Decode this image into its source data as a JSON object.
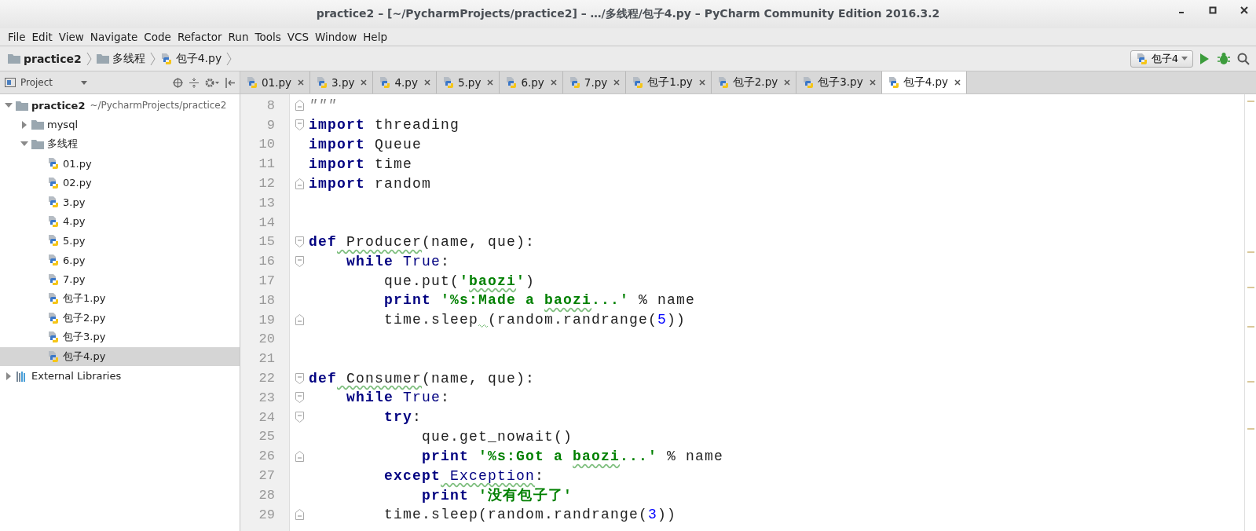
{
  "window": {
    "title": "practice2 – [~/PycharmProjects/practice2] – …/多线程/包子4.py – PyCharm Community Edition 2016.3.2"
  },
  "menu": [
    "File",
    "Edit",
    "View",
    "Navigate",
    "Code",
    "Refactor",
    "Run",
    "Tools",
    "VCS",
    "Window",
    "Help"
  ],
  "breadcrumbs": [
    {
      "label": "practice2",
      "kind": "folder"
    },
    {
      "label": "多线程",
      "kind": "folder"
    },
    {
      "label": "包子4.py",
      "kind": "file"
    }
  ],
  "run_config": {
    "label": "包子4"
  },
  "project_panel": {
    "title": "Project"
  },
  "tree": [
    {
      "label": "practice2",
      "path": "~/PycharmProjects/practice2",
      "kind": "folder",
      "expanded": true,
      "selected": false,
      "children": [
        {
          "label": "mysql",
          "kind": "folder",
          "expanded": false,
          "selected": false
        },
        {
          "label": "多线程",
          "kind": "folder",
          "expanded": true,
          "selected": false,
          "children": [
            {
              "label": "01.py",
              "kind": "file",
              "selected": false
            },
            {
              "label": "02.py",
              "kind": "file",
              "selected": false
            },
            {
              "label": "3.py",
              "kind": "file",
              "selected": false
            },
            {
              "label": "4.py",
              "kind": "file",
              "selected": false
            },
            {
              "label": "5.py",
              "kind": "file",
              "selected": false
            },
            {
              "label": "6.py",
              "kind": "file",
              "selected": false
            },
            {
              "label": "7.py",
              "kind": "file",
              "selected": false
            },
            {
              "label": "包子1.py",
              "kind": "file",
              "selected": false
            },
            {
              "label": "包子2.py",
              "kind": "file",
              "selected": false
            },
            {
              "label": "包子3.py",
              "kind": "file",
              "selected": false
            },
            {
              "label": "包子4.py",
              "kind": "file",
              "selected": true
            }
          ]
        }
      ]
    },
    {
      "label": "External Libraries",
      "kind": "library",
      "expanded": false,
      "selected": false
    }
  ],
  "tabs": [
    {
      "label": "01.py",
      "selected": false
    },
    {
      "label": "3.py",
      "selected": false
    },
    {
      "label": "4.py",
      "selected": false
    },
    {
      "label": "5.py",
      "selected": false
    },
    {
      "label": "6.py",
      "selected": false
    },
    {
      "label": "7.py",
      "selected": false
    },
    {
      "label": "包子1.py",
      "selected": false
    },
    {
      "label": "包子2.py",
      "selected": false
    },
    {
      "label": "包子3.py",
      "selected": false
    },
    {
      "label": "包子4.py",
      "selected": true
    }
  ],
  "code": [
    {
      "number": "8",
      "fold_end": true,
      "tokens": [
        {
          "t": "\"\"\"",
          "kind": "doc"
        }
      ]
    },
    {
      "number": "9",
      "fold_start": true,
      "tokens": [
        {
          "t": "import",
          "kind": "kw"
        },
        {
          "t": " threading",
          "kind": "plain"
        }
      ]
    },
    {
      "number": "10",
      "tokens": [
        {
          "t": "import",
          "kind": "kw"
        },
        {
          "t": " Queue",
          "kind": "plain"
        }
      ]
    },
    {
      "number": "11",
      "tokens": [
        {
          "t": "import",
          "kind": "kw"
        },
        {
          "t": " time",
          "kind": "plain"
        }
      ]
    },
    {
      "number": "12",
      "fold_end": true,
      "tokens": [
        {
          "t": "import",
          "kind": "kw"
        },
        {
          "t": " random",
          "kind": "plain"
        }
      ]
    },
    {
      "number": "13"
    },
    {
      "number": "14"
    },
    {
      "number": "15",
      "fold_start": true,
      "tokens": [
        {
          "t": "def",
          "kind": "kw"
        },
        {
          "t": " Producer",
          "kind": "plain",
          "warn": true
        },
        {
          "t": "(name, que):",
          "kind": "plain"
        }
      ]
    },
    {
      "number": "16",
      "fold_start": true,
      "tokens": [
        {
          "t": "    while",
          "kind": "kw"
        },
        {
          "t": " True",
          "kind": "builtin"
        },
        {
          "t": ":",
          "kind": "plain"
        }
      ]
    },
    {
      "number": "17",
      "tokens": [
        {
          "t": "        que.put(",
          "kind": "plain"
        },
        {
          "t": "'",
          "kind": "str"
        },
        {
          "t": "baozi",
          "kind": "str",
          "warn": true
        },
        {
          "t": "'",
          "kind": "str"
        },
        {
          "t": ")",
          "kind": "plain"
        }
      ]
    },
    {
      "number": "18",
      "tokens": [
        {
          "t": "        print",
          "kind": "kw"
        },
        {
          "t": " '%s:Made a ",
          "kind": "str"
        },
        {
          "t": "baozi",
          "kind": "str",
          "warn": true
        },
        {
          "t": "...'",
          "kind": "str"
        },
        {
          "t": " % name",
          "kind": "plain"
        }
      ]
    },
    {
      "number": "19",
      "fold_end": true,
      "tokens": [
        {
          "t": "        time.sleep",
          "kind": "plain",
          "warn_after": true
        },
        {
          "t": "(random.randrange(",
          "kind": "plain"
        },
        {
          "t": "5",
          "kind": "num"
        },
        {
          "t": "))",
          "kind": "plain"
        }
      ]
    },
    {
      "number": "20"
    },
    {
      "number": "21"
    },
    {
      "number": "22",
      "fold_start": true,
      "tokens": [
        {
          "t": "def",
          "kind": "kw"
        },
        {
          "t": " Consumer",
          "kind": "plain",
          "warn": true
        },
        {
          "t": "(name, que):",
          "kind": "plain"
        }
      ]
    },
    {
      "number": "23",
      "fold_start": true,
      "tokens": [
        {
          "t": "    while",
          "kind": "kw"
        },
        {
          "t": " True",
          "kind": "builtin"
        },
        {
          "t": ":",
          "kind": "plain"
        }
      ]
    },
    {
      "number": "24",
      "fold_start": true,
      "tokens": [
        {
          "t": "        try",
          "kind": "kw"
        },
        {
          "t": ":",
          "kind": "plain"
        }
      ]
    },
    {
      "number": "25",
      "tokens": [
        {
          "t": "            que.get_nowait()",
          "kind": "plain"
        }
      ]
    },
    {
      "number": "26",
      "fold_end": true,
      "tokens": [
        {
          "t": "            print",
          "kind": "kw"
        },
        {
          "t": " '%s:Got a ",
          "kind": "str"
        },
        {
          "t": "baozi",
          "kind": "str",
          "warn": true
        },
        {
          "t": "...'",
          "kind": "str"
        },
        {
          "t": " % name",
          "kind": "plain"
        }
      ]
    },
    {
      "number": "27",
      "tokens": [
        {
          "t": "        except",
          "kind": "kw"
        },
        {
          "t": " Exception",
          "kind": "builtin",
          "warn": true
        },
        {
          "t": ":",
          "kind": "plain"
        }
      ]
    },
    {
      "number": "28",
      "tokens": [
        {
          "t": "            print",
          "kind": "kw"
        },
        {
          "t": " '没有包子了'",
          "kind": "str"
        }
      ]
    },
    {
      "number": "29",
      "fold_end": true,
      "tokens": [
        {
          "t": "        time.sleep(random.randrange(",
          "kind": "plain"
        },
        {
          "t": "3",
          "kind": "num"
        },
        {
          "t": "))",
          "kind": "plain"
        }
      ]
    }
  ]
}
